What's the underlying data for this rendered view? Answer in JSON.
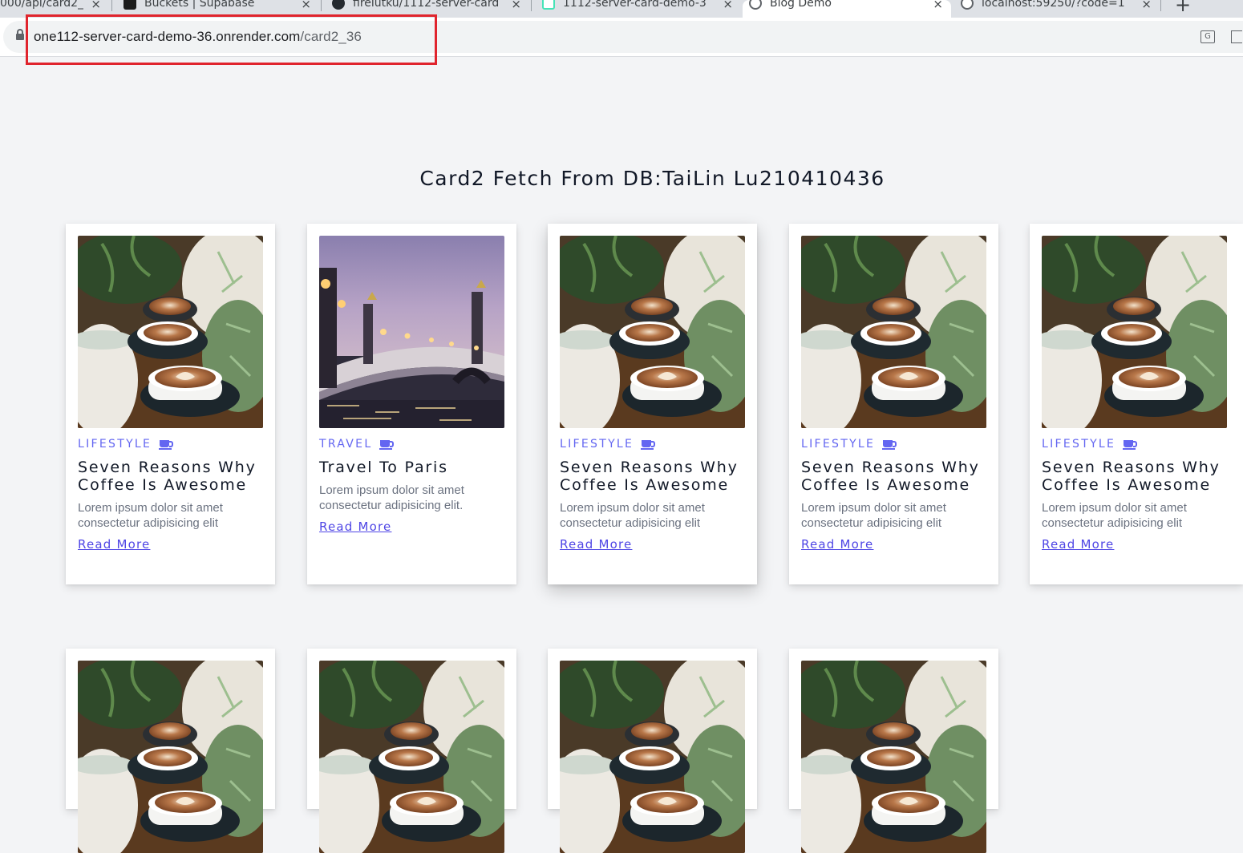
{
  "browser": {
    "tabs": [
      {
        "title": "000/api/card2_",
        "favicon": "page-icon",
        "active": false
      },
      {
        "title": "Buckets | Supabase",
        "favicon": "supabase-icon",
        "active": false
      },
      {
        "title": "firelutku/1112-server-card",
        "favicon": "github-icon",
        "active": false
      },
      {
        "title": "1112-server-card-demo-3",
        "favicon": "render-icon",
        "active": false
      },
      {
        "title": "Blog Demo",
        "favicon": "globe-icon",
        "active": true
      },
      {
        "title": "localhost:59250/?code=1",
        "favicon": "globe-icon",
        "active": false
      }
    ],
    "new_tab": "+",
    "close_glyph": "×",
    "url_host": "one112-server-card-demo-36.onrender.com",
    "url_path": "/card2_36",
    "translate_glyph": "G"
  },
  "page": {
    "title": "Card2 Fetch From DB:TaiLin Lu210410436"
  },
  "cards": [
    {
      "image": "coffee",
      "category": "LIFESTYLE",
      "title": "Seven Reasons Why Coffee Is Awesome",
      "text": "Lorem ipsum dolor sit amet consectetur adipisicing elit",
      "link": "Read More"
    },
    {
      "image": "paris",
      "category": "TRAVEL",
      "title": "Travel To Paris",
      "text": "Lorem ipsum dolor sit amet consectetur adipisicing elit.",
      "link": "Read More"
    },
    {
      "image": "coffee",
      "category": "LIFESTYLE",
      "title": "Seven Reasons Why Coffee Is Awesome",
      "text": "Lorem ipsum dolor sit amet consectetur adipisicing elit",
      "link": "Read More"
    },
    {
      "image": "coffee",
      "category": "LIFESTYLE",
      "title": "Seven Reasons Why Coffee Is Awesome",
      "text": "Lorem ipsum dolor sit amet consectetur adipisicing elit",
      "link": "Read More"
    },
    {
      "image": "coffee",
      "category": "LIFESTYLE",
      "title": "Seven Reasons Why Coffee Is Awesome",
      "text": "Lorem ipsum dolor sit amet consectetur adipisicing elit",
      "link": "Read More"
    },
    {
      "image": "coffee"
    },
    {
      "image": "coffee"
    },
    {
      "image": "coffee"
    },
    {
      "image": "coffee"
    }
  ],
  "colors": {
    "accent": "#6366f1",
    "link": "#4f46e5",
    "page_bg": "#f3f4f6",
    "highlight": "#e0242d"
  }
}
